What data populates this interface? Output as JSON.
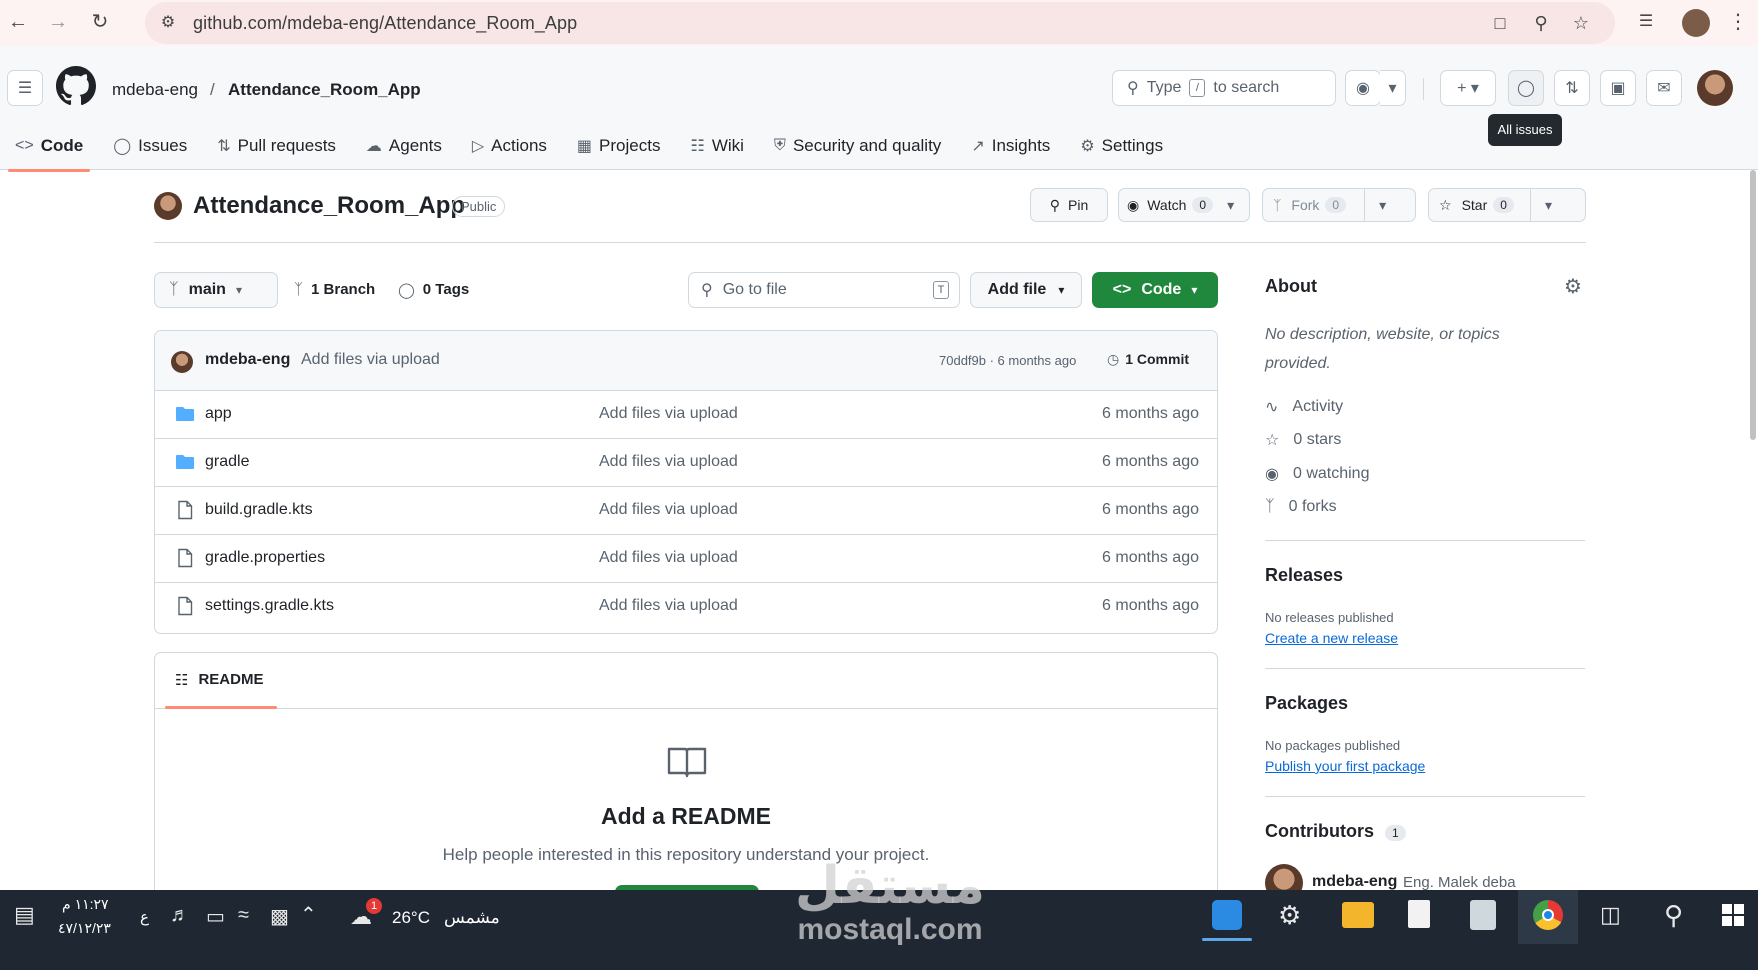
{
  "browser": {
    "url": "github.com/mdeba-eng/Attendance_Room_App",
    "back_icon": "arrow-left-icon",
    "forward_icon": "arrow-right-icon",
    "reload_icon": "reload-icon"
  },
  "header": {
    "owner": "mdeba-eng",
    "separator": "/",
    "repo": "Attendance_Room_App",
    "search_prefix": "Type",
    "search_key": "/",
    "search_suffix": "to search",
    "tooltip": "All issues"
  },
  "tabs": [
    {
      "label": "Code",
      "icon": "code-icon"
    },
    {
      "label": "Issues",
      "icon": "issue-icon"
    },
    {
      "label": "Pull requests",
      "icon": "pull-request-icon"
    },
    {
      "label": "Agents",
      "icon": "agents-icon"
    },
    {
      "label": "Actions",
      "icon": "play-icon"
    },
    {
      "label": "Projects",
      "icon": "table-icon"
    },
    {
      "label": "Wiki",
      "icon": "book-icon"
    },
    {
      "label": "Security and quality",
      "icon": "shield-icon"
    },
    {
      "label": "Insights",
      "icon": "graph-icon"
    },
    {
      "label": "Settings",
      "icon": "gear-icon"
    }
  ],
  "repo": {
    "name": "Attendance_Room_App",
    "visibility": "Public",
    "pin_label": "Pin",
    "watch_label": "Watch",
    "watch_count": "0",
    "fork_label": "Fork",
    "fork_count": "0",
    "star_label": "Star",
    "star_count": "0"
  },
  "toolbar": {
    "branch": "main",
    "branches": "1 Branch",
    "tags": "0 Tags",
    "goto_placeholder": "Go to file",
    "goto_key": "T",
    "add_file": "Add file",
    "code_button": "Code"
  },
  "commit": {
    "author": "mdeba-eng",
    "message": "Add files via upload",
    "hash_time": "70ddf9b · 6 months ago",
    "commits": "1 Commit"
  },
  "files": [
    {
      "name": "app",
      "type": "dir",
      "message": "Add files via upload",
      "date": "6 months ago"
    },
    {
      "name": "gradle",
      "type": "dir",
      "message": "Add files via upload",
      "date": "6 months ago"
    },
    {
      "name": "build.gradle.kts",
      "type": "file",
      "message": "Add files via upload",
      "date": "6 months ago"
    },
    {
      "name": "gradle.properties",
      "type": "file",
      "message": "Add files via upload",
      "date": "6 months ago"
    },
    {
      "name": "settings.gradle.kts",
      "type": "file",
      "message": "Add files via upload",
      "date": "6 months ago"
    }
  ],
  "readme": {
    "tab": "README",
    "title": "Add a README",
    "subtitle": "Help people interested in this repository understand your project."
  },
  "about": {
    "heading": "About",
    "description": "No description, website, or topics provided.",
    "activity": "Activity",
    "stars": "0 stars",
    "watching": "0 watching",
    "forks": "0 forks"
  },
  "releases": {
    "heading": "Releases",
    "empty": "No releases published",
    "link": "Create a new release"
  },
  "packages": {
    "heading": "Packages",
    "empty": "No packages published",
    "link": "Publish your first package"
  },
  "contributors": {
    "heading": "Contributors",
    "count": "1",
    "user": "mdeba-eng",
    "fullname": "Eng. Malek deba"
  },
  "taskbar": {
    "time": "١١:٢٧ م",
    "date": "٤٧/١٢/٢٣",
    "lang": "ع",
    "temp": "26°C",
    "weather": "مشمس",
    "weather_badge": "1"
  },
  "watermark": {
    "arabic": "مستقل",
    "latin": "mostaql.com"
  },
  "colors": {
    "accent_green": "#1f883d",
    "link_blue": "#0969da",
    "tab_underline": "#fd8c73",
    "taskbar": "#1e2732"
  }
}
